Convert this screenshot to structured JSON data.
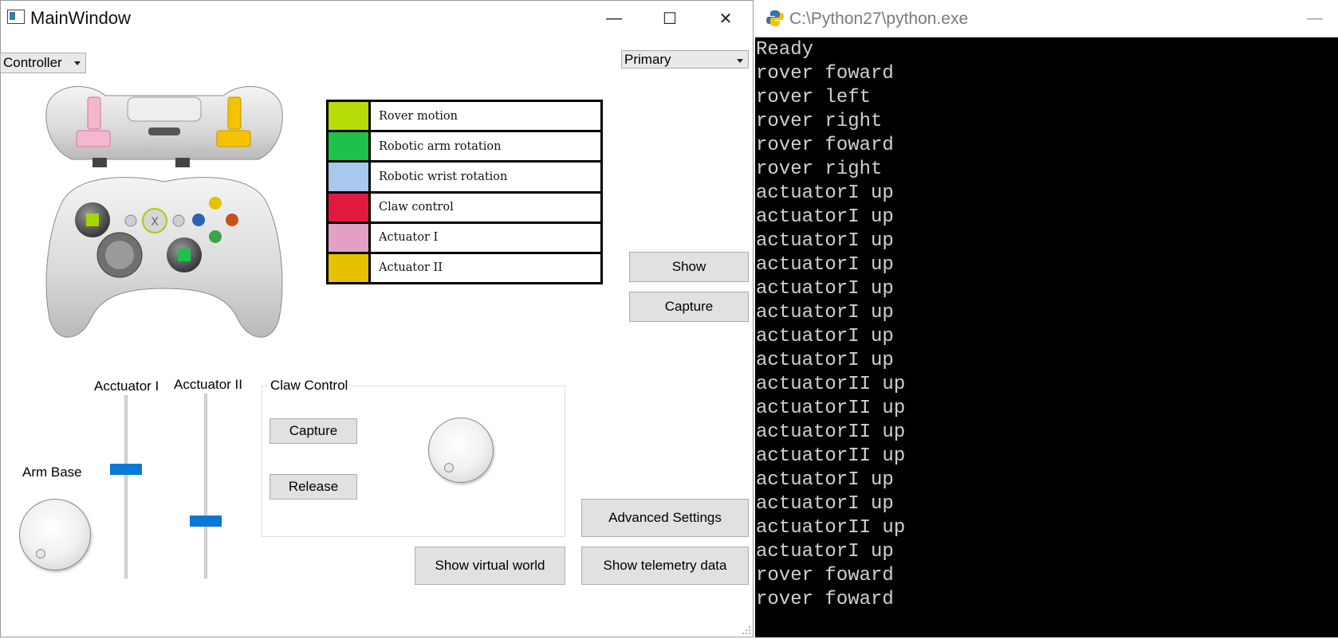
{
  "main_window": {
    "title": "MainWindow",
    "controls": {
      "minimize": "—",
      "maximize": "☐",
      "close": "✕"
    },
    "mode_combo": "Controller",
    "screen_combo": "Primary",
    "legend": [
      {
        "label": "Rover motion",
        "color": "#b7dd08"
      },
      {
        "label": "Robotic arm rotation",
        "color": "#1ec14a"
      },
      {
        "label": "Robotic wrist rotation",
        "color": "#a9c8ee"
      },
      {
        "label": "Claw control",
        "color": "#e2193f"
      },
      {
        "label": "Actuator I",
        "color": "#e3a0c4"
      },
      {
        "label": "Actuator II",
        "color": "#e6c100"
      }
    ],
    "buttons": {
      "show": "Show",
      "capture_top": "Capture",
      "advanced_settings": "Advanced Settings",
      "show_telemetry": "Show telemetry data",
      "show_virtual_world": "Show virtual world"
    },
    "sliders": {
      "actuator1_label": "Acctuator I",
      "actuator2_label": "Acctuator II",
      "actuator1_value": 0.6,
      "actuator2_value": 0.3
    },
    "arm_base_label": "Arm Base",
    "claw": {
      "title": "Claw Control",
      "capture": "Capture",
      "release": "Release"
    },
    "accent_color": "#0a78d7"
  },
  "console": {
    "title": "C:\\Python27\\python.exe",
    "minimize": "—",
    "lines": [
      "Ready",
      "rover foward",
      "rover left",
      "rover right",
      "rover foward",
      "rover right",
      "actuatorI up",
      "actuatorI up",
      "actuatorI up",
      "actuatorI up",
      "actuatorI up",
      "actuatorI up",
      "actuatorI up",
      "actuatorI up",
      "actuatorII up",
      "actuatorII up",
      "actuatorII up",
      "actuatorII up",
      "actuatorI up",
      "actuatorI up",
      "actuatorII up",
      "actuatorI up",
      "rover foward",
      "rover foward"
    ]
  }
}
